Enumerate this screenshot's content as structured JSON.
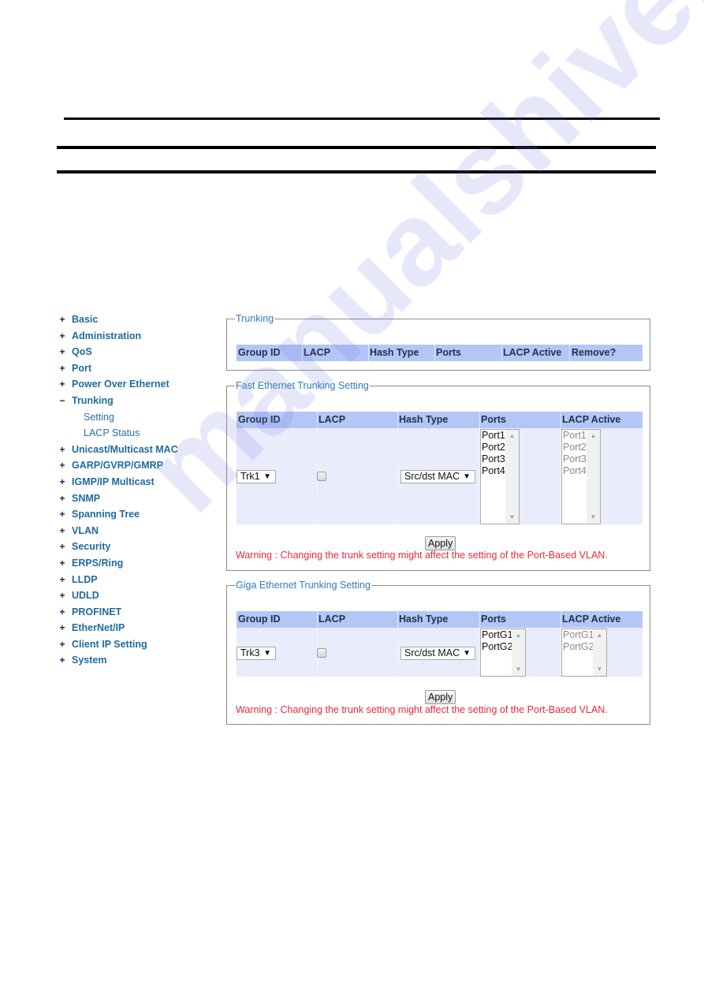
{
  "sidebar": {
    "items": [
      {
        "sign": "+",
        "label": "Basic"
      },
      {
        "sign": "+",
        "label": "Administration"
      },
      {
        "sign": "+",
        "label": "QoS"
      },
      {
        "sign": "+",
        "label": "Port"
      },
      {
        "sign": "+",
        "label": "Power Over Ethernet"
      },
      {
        "sign": "−",
        "label": "Trunking"
      },
      {
        "sub": true,
        "label": "Setting"
      },
      {
        "sub": true,
        "label": "LACP Status"
      },
      {
        "sign": "+",
        "label": "Unicast/Multicast MAC"
      },
      {
        "sign": "+",
        "label": "GARP/GVRP/GMRP"
      },
      {
        "sign": "+",
        "label": "IGMP/IP Multicast"
      },
      {
        "sign": "+",
        "label": "SNMP"
      },
      {
        "sign": "+",
        "label": "Spanning Tree"
      },
      {
        "sign": "+",
        "label": "VLAN"
      },
      {
        "sign": "+",
        "label": "Security"
      },
      {
        "sign": "+",
        "label": "ERPS/Ring"
      },
      {
        "sign": "+",
        "label": "LLDP"
      },
      {
        "sign": "+",
        "label": "UDLD"
      },
      {
        "sign": "+",
        "label": "PROFINET"
      },
      {
        "sign": "+",
        "label": "EtherNet/IP"
      },
      {
        "sign": "+",
        "label": "Client IP Setting"
      },
      {
        "sign": "+",
        "label": "System"
      }
    ]
  },
  "trunking": {
    "legend": "Trunking",
    "columns": [
      "Group ID",
      "LACP",
      "Hash Type",
      "Ports",
      "LACP Active",
      "Remove?"
    ]
  },
  "fast_ethernet": {
    "legend": "Fast Ethernet Trunking Setting",
    "columns": [
      "Group ID",
      "LACP",
      "Hash Type",
      "Ports",
      "LACP Active"
    ],
    "group_id": "Trk1",
    "lacp_checked": false,
    "hash_type": "Src/dst MAC",
    "ports": [
      "Port1",
      "Port2",
      "Port3",
      "Port4"
    ],
    "lacp_active": [
      "Port1",
      "Port2",
      "Port3",
      "Port4"
    ],
    "apply_label": "Apply",
    "warning": "Warning : Changing the trunk setting might affect the setting of the Port-Based VLAN."
  },
  "giga_ethernet": {
    "legend": "Giga Ethernet Trunking Setting",
    "columns": [
      "Group ID",
      "LACP",
      "Hash Type",
      "Ports",
      "LACP Active"
    ],
    "group_id": "Trk3",
    "lacp_checked": false,
    "hash_type": "Src/dst MAC",
    "ports": [
      "PortG1",
      "PortG2"
    ],
    "lacp_active": [
      "PortG1",
      "PortG2"
    ],
    "apply_label": "Apply",
    "warning": "Warning : Changing the trunk setting might affect the setting of the Port-Based VLAN."
  },
  "icons": {
    "dropdown_arrow": "▼",
    "scroll_up": "▲",
    "scroll_down": "▼"
  },
  "watermark": "manualshive.com",
  "colors": {
    "header_bg": "#b3c6f6",
    "row_bg": "#e9ecfb",
    "legend": "#2f7bbf",
    "nav_text": "#1f6aa0",
    "warning": "#f0283c"
  }
}
